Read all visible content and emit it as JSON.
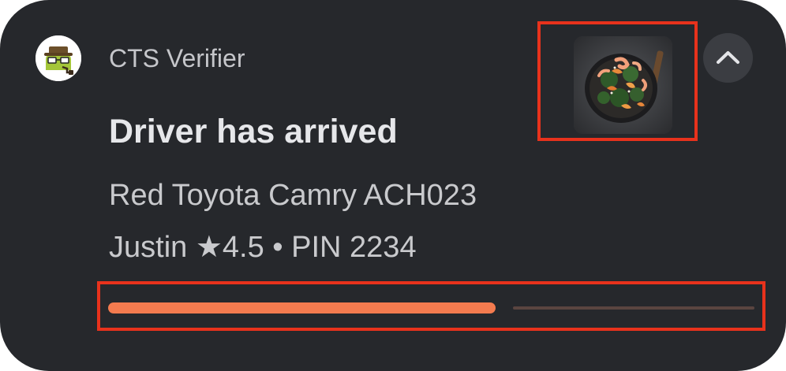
{
  "notification": {
    "app_name": "CTS Verifier",
    "title": "Driver has arrived",
    "vehicle": "Red Toyota Camry ACH023",
    "driver_line": "Justin ★4.5 • PIN 2234",
    "app_icon": "cts-verifier-icon",
    "thumbnail": "food-skillet-image",
    "expand_icon": "chevron-up-icon",
    "progress_fraction": 0.6
  },
  "colors": {
    "background": "#26282c",
    "accent": "#f47b4f",
    "highlight_box": "#e8321c"
  }
}
